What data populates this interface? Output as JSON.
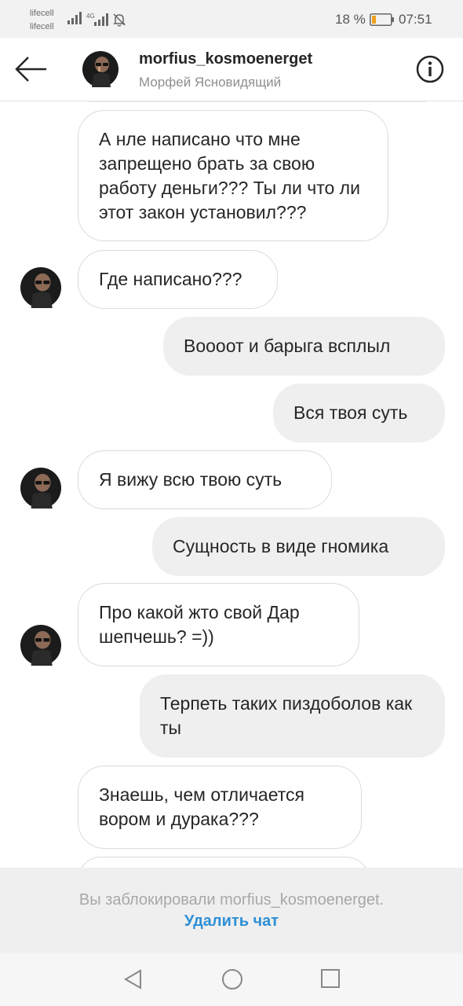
{
  "status_bar": {
    "carrier1": "lifecell",
    "carrier2": "lifecell",
    "network": "4G",
    "battery_pct": "18 %",
    "time": "07:51",
    "icons": [
      "signal-icon",
      "signal-4g-icon",
      "mute-bell-icon",
      "battery-icon"
    ]
  },
  "header": {
    "username": "morfius_kosmoenerget",
    "full_name": "Морфей Ясновидящий",
    "icons": [
      "back-arrow-icon",
      "info-icon"
    ]
  },
  "messages": [
    {
      "side": "in",
      "text": "А нле написано что мне запрещено брать за свою работу деньги??? Ты ли что ли этот закон установил???"
    },
    {
      "side": "in",
      "text": "Где написано???"
    },
    {
      "side": "out",
      "text": "Воооот и барыга всплыл"
    },
    {
      "side": "out",
      "text": "Вся твоя суть"
    },
    {
      "side": "in",
      "text": "Я вижу всю твою суть"
    },
    {
      "side": "out",
      "text": "Сущность в виде гномика"
    },
    {
      "side": "in",
      "text": "Про какой жто свой Дар шепчешь? =))"
    },
    {
      "side": "out",
      "text": "Терпеть таких пиздоболов как ты"
    },
    {
      "side": "in",
      "text": "Знаешь, чем отличается вором и дурака???"
    }
  ],
  "blocked": {
    "text": "Вы заблокировали morfius_kosmoenerget.",
    "delete_label": "Удалить чат"
  },
  "navbar": {
    "icons": [
      "nav-back-icon",
      "nav-home-icon",
      "nav-recents-icon"
    ]
  },
  "colors": {
    "accent": "#2d8fd6",
    "outgoing_bubble": "#efefef",
    "incoming_border": "#dbdbdb"
  }
}
